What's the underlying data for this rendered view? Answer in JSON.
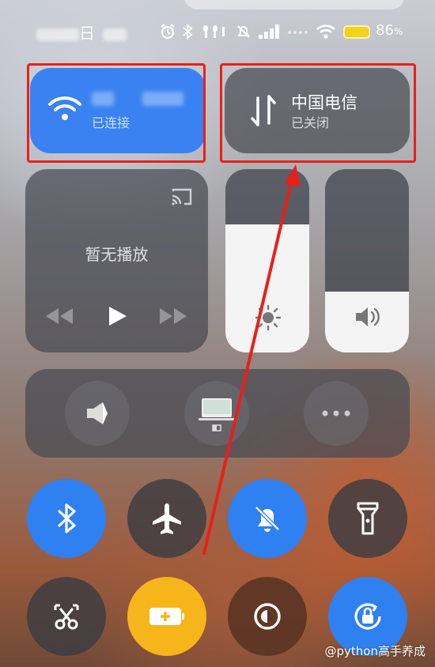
{
  "status_bar": {
    "time_suffix": "日",
    "battery_percent": "86",
    "battery_unit": "%"
  },
  "tiles": {
    "wifi": {
      "status": "已连接",
      "active": true
    },
    "cellular": {
      "title": "中国电信",
      "status": "已关闭",
      "active": false
    },
    "media": {
      "text": "暂无播放"
    }
  },
  "sliders": {
    "brightness_level": 0.7,
    "volume_level": 0.33
  },
  "toggles": [
    {
      "name": "bluetooth",
      "active": true
    },
    {
      "name": "airplane-mode",
      "active": false
    },
    {
      "name": "silent-mode",
      "active": true
    },
    {
      "name": "flashlight",
      "active": false
    },
    {
      "name": "screenshot",
      "active": false
    },
    {
      "name": "battery-saver",
      "active": true
    },
    {
      "name": "dark-mode",
      "active": false
    },
    {
      "name": "rotation-lock",
      "active": true
    }
  ],
  "colors": {
    "accent_blue": "#2f80f0",
    "battery_saver": "#f7b51c",
    "annotation_red": "#e8201a"
  },
  "watermark": "@python高手养成"
}
